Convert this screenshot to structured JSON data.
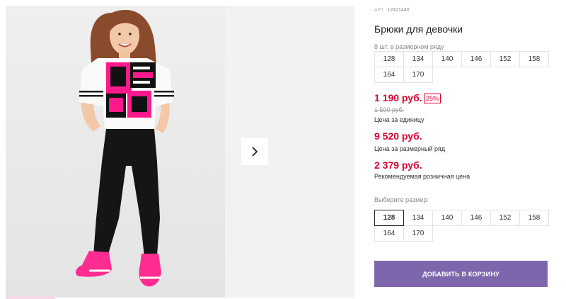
{
  "product": {
    "sku_label": "АРТ.",
    "sku_value": "12421440",
    "title": "Брюки для девочки",
    "pack_note": "8 шт. в размерном ряду",
    "pack_sizes": [
      "128",
      "134",
      "140",
      "146",
      "152",
      "158",
      "164",
      "170"
    ],
    "price_unit": "1 190 руб.",
    "discount_badge": "25%",
    "price_old": "1 590 руб.",
    "price_unit_caption": "Цена за единицу",
    "price_pack": "9 520 руб.",
    "price_pack_caption": "Цена за размерный ряд",
    "price_rrp": "2 379 руб.",
    "price_rrp_caption": "Рекомендуемая розничная цена"
  },
  "size_picker": {
    "label": "Выберите размер:",
    "sizes": [
      "128",
      "134",
      "140",
      "146",
      "152",
      "158",
      "164",
      "170"
    ],
    "selected": "128"
  },
  "cart": {
    "button_label": "ДОБАВИТЬ В КОРЗИНУ"
  },
  "gallery": {
    "next_icon": "chevron-right-icon",
    "photo_icon": "product-photo"
  },
  "colors": {
    "accent_price": "#d7002d",
    "cart_button": "#7e66ad",
    "photo_pink": "#ff1a8c"
  }
}
